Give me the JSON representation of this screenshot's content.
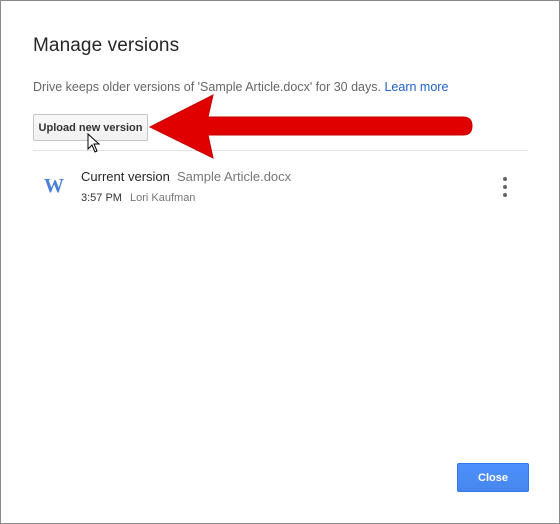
{
  "dialog": {
    "title": "Manage versions",
    "description": "Drive keeps older versions of 'Sample Article.docx' for 30 days.",
    "learn_more": "Learn more",
    "upload_label": "Upload new version",
    "close_label": "Close"
  },
  "versions": [
    {
      "file_icon": "W",
      "label": "Current version",
      "file_name": "Sample Article.docx",
      "time": "3:57 PM",
      "author": "Lori Kaufman"
    }
  ],
  "colors": {
    "accent_blue": "#4d90fe",
    "link_blue": "#1f61c7",
    "arrow_red": "#e00000",
    "word_icon_blue": "#4a80d9"
  },
  "icons": {
    "file_icon": "word-doc-icon",
    "more_icon": "more-vert-icon",
    "annotation": "red-arrow-annotation",
    "cursor": "mouse-pointer-icon"
  }
}
